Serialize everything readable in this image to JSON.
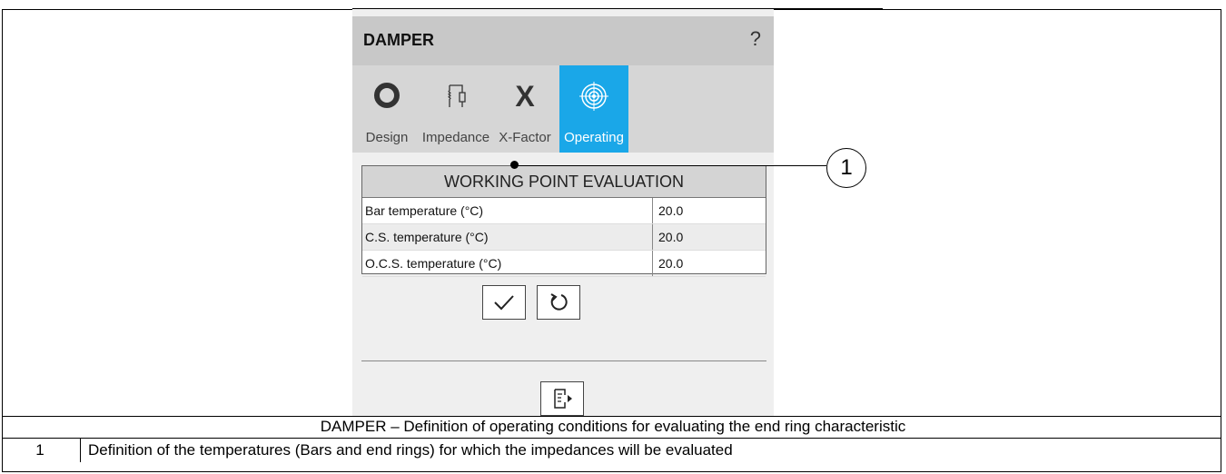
{
  "panel": {
    "title": "DAMPER",
    "help_label": "?"
  },
  "tabs": [
    {
      "label": "Design",
      "icon": "ring-icon"
    },
    {
      "label": "Impedance",
      "icon": "coil-icon"
    },
    {
      "label": "X-Factor",
      "icon": "x-icon"
    },
    {
      "label": "Operating",
      "icon": "target-icon",
      "active": true
    }
  ],
  "working_point": {
    "title": "WORKING POINT EVALUATION",
    "rows": [
      {
        "label": "Bar temperature (°C)",
        "value": "20.0"
      },
      {
        "label": "C.S. temperature (°C)",
        "value": "20.0"
      },
      {
        "label": "O.C.S. temperature (°C)",
        "value": "20.0"
      }
    ]
  },
  "buttons": {
    "confirm": "check-icon",
    "reset": "reset-icon",
    "export": "export-icon"
  },
  "callout": {
    "number": "1"
  },
  "caption": "DAMPER – Definition of operating conditions for evaluating the end ring characteristic",
  "notes": [
    {
      "number": "1",
      "text": "Definition of the temperatures (Bars and end rings) for which the impedances will be evaluated"
    }
  ],
  "colors": {
    "active_tab": "#1aa7e8",
    "header": "#c8c8c8"
  }
}
